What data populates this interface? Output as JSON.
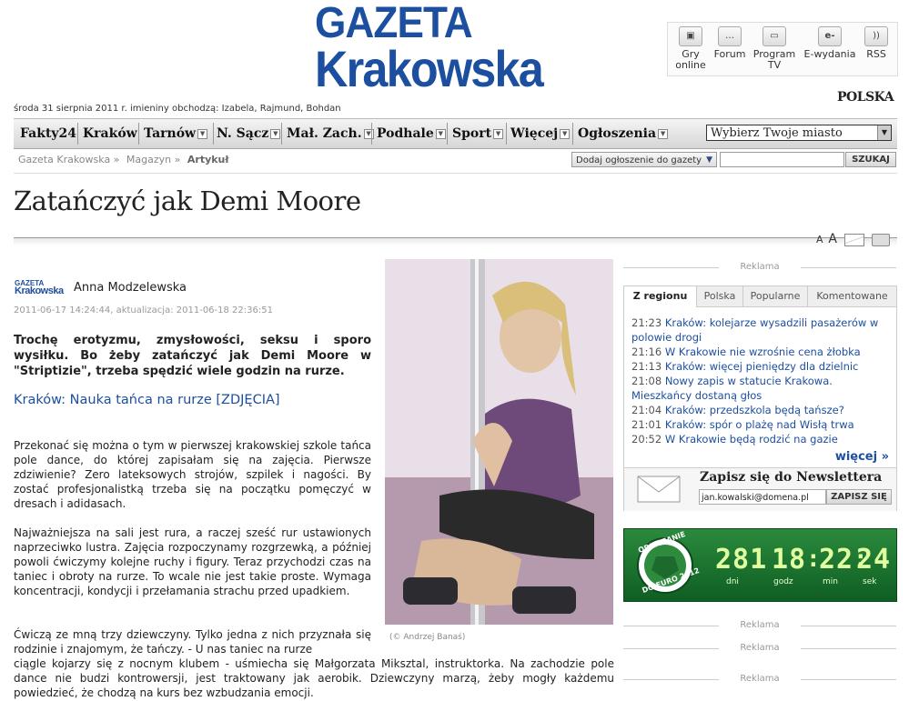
{
  "header": {
    "logo_line1": "GAZETA",
    "logo_line2": "Krakowska",
    "date_line": "środa 31 sierpnia 2011 r. imieniny obchodzą: Izabela, Rajmund, Bohdan",
    "partner_logo": "POLSKA",
    "top_links": [
      {
        "label": "Gry online",
        "icon": "gamepad-icon"
      },
      {
        "label": "Forum",
        "icon": "speech-bubble-icon"
      },
      {
        "label": "Program TV",
        "icon": "tv-icon"
      },
      {
        "label": "E-wydania",
        "icon": "e-edition-icon"
      },
      {
        "label": "RSS",
        "icon": "rss-icon"
      }
    ]
  },
  "nav": {
    "items": [
      "Fakty24",
      "Kraków",
      "Tarnów",
      "N. Sącz",
      "Mał. Zach.",
      "Podhale",
      "Sport",
      "Więcej",
      "Ogłoszenia"
    ],
    "city_select": "Wybierz Twoje miasto"
  },
  "breadcrumb": {
    "items": [
      "Gazeta Krakowska",
      "Magazyn"
    ],
    "current": "Artykuł"
  },
  "toolbar": {
    "add_ad": "Dodaj ogłoszenie do gazety",
    "search_button": "SZUKAJ",
    "font_small": "A",
    "font_large": "A"
  },
  "article": {
    "title": "Zatańczyć jak Demi Moore",
    "source_logo_1": "GAZETA",
    "source_logo_2": "Krakowska",
    "author": "Anna Modzelewska",
    "meta": "2011-06-17 14:24:44, aktualizacja: 2011-06-18 22:36:51",
    "lead": "Trochę erotyzmu, zmysłowości, seksu i sporo wysiłku. Bo żeby zatańczyć jak Demi Moore w \"Striptizie\", trzeba spędzić wiele godzin na rurze.",
    "related_link": "Kraków: Nauka tańca na rurze [ZDJĘCIA]",
    "paragraphs": [
      "Przekonać się można o tym w pierwszej krakowskiej szkole tańca pole dance, do której zapisałam się na zajęcia. Pierwsze zdziwienie? Zero lateksowych strojów, szpilek i nagości. By zostać profesjonalistką trzeba się na początku pomęczyć w dresach i adidasach.",
      "Najważniejsza na sali jest rura, a raczej sześć rur ustawionych naprzeciwko lustra. Zajęcia rozpoczynamy rozgrzewką, a później powoli ćwiczymy kolejne ruchy i figury. Teraz przychodzi czas na taniec i obroty na rurze. To wcale nie jest takie proste. Wymaga koncentracji, kondycji i przełamania strachu przed upadkiem.",
      "Ćwiczą ze mną trzy dziewczyny. Tylko jedna z nich przyznała się rodzinie i znajomym, że tańczy. - U nas taniec na rurze",
      "ciągle kojarzy się z nocnym klubem - uśmiecha się Małgorzata Miksztal, instruktorka. Na zachodzie pole dance nie budzi kontrowersji, jest traktowany jak aerobik. Dziewczyny marzą, żeby mogły każdemu powiedzieć, że chodzą na kurs bez wzbudzania emocji."
    ],
    "photo_credit": "(© Andrzej Banaś)"
  },
  "sidebar": {
    "ad_label": "Reklama",
    "tabs": [
      "Z regionu",
      "Polska",
      "Popularne",
      "Komentowane"
    ],
    "news": [
      {
        "time": "21:23",
        "text": "Kraków: kolejarze wysadzili pasażerów w polowie drogi"
      },
      {
        "time": "21:16",
        "text": "W Krakowie nie wzrośnie cena żłobka"
      },
      {
        "time": "21:13",
        "text": "Kraków: więcej pieniędzy dla dzielnic"
      },
      {
        "time": "21:08",
        "text": "Nowy zapis w statucie Krakowa. Mieszkańcy dostaną głos"
      },
      {
        "time": "21:04",
        "text": "Kraków: przedszkola będą tańsze?"
      },
      {
        "time": "21:01",
        "text": "Kraków: spór o plażę nad Wisłą trwa"
      },
      {
        "time": "20:52",
        "text": "W Krakowie będą rodzić na gazie"
      }
    ],
    "more": "więcej »",
    "newsletter_title": "Zapisz się do Newslettera",
    "newsletter_email": "jan.kowalski@domena.pl",
    "newsletter_button": "ZAPISZ SIĘ",
    "euro": {
      "badge_1": "ODLICZANIE",
      "badge_2": "DO EURO 2012",
      "days": "281",
      "hours": "18",
      "minutes": "22",
      "seconds": "24",
      "label_days": "dni",
      "label_hours": "godz",
      "label_minutes": "min",
      "label_seconds": "sek"
    }
  }
}
